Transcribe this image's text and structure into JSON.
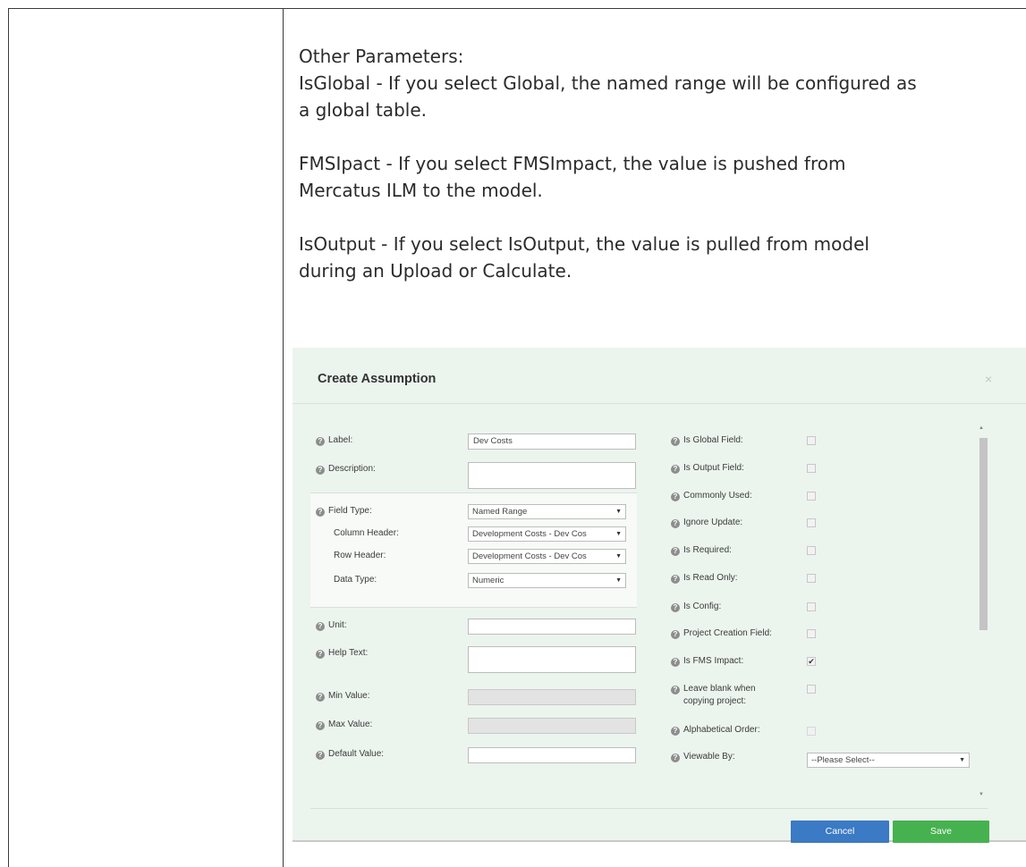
{
  "doc": {
    "lines": [
      "Other Parameters:",
      "IsGlobal - If you select Global, the named range will be configured as",
      "a global table.",
      "FMSIpact - If you select FMSImpact, the value is pushed from",
      "Mercatus ILM to the model.",
      "IsOutput - If you select IsOutput, the value is pulled from model",
      "during an Upload or Calculate."
    ]
  },
  "dialog": {
    "title": "Create Assumption",
    "close_symbol": "×",
    "left_fields": {
      "label": {
        "label": "Label:",
        "value": "Dev Costs"
      },
      "description": {
        "label": "Description:",
        "value": ""
      },
      "field_type": {
        "label": "Field Type:",
        "value": "Named Range"
      },
      "column_header": {
        "label": "Column Header:",
        "value": "Development Costs - Dev Cos"
      },
      "row_header": {
        "label": "Row Header:",
        "value": "Development Costs - Dev Cos"
      },
      "data_type": {
        "label": "Data Type:",
        "value": "Numeric"
      },
      "unit": {
        "label": "Unit:",
        "value": ""
      },
      "help_text": {
        "label": "Help Text:",
        "value": ""
      },
      "min_value": {
        "label": "Min Value:",
        "value": ""
      },
      "max_value": {
        "label": "Max Value:",
        "value": ""
      },
      "default_value": {
        "label": "Default Value:",
        "value": ""
      }
    },
    "right_fields": {
      "is_global": {
        "label": "Is Global Field:",
        "checked": false
      },
      "is_output": {
        "label": "Is Output Field:",
        "checked": false
      },
      "commonly_used": {
        "label": "Commonly Used:",
        "checked": false
      },
      "ignore_update": {
        "label": "Ignore Update:",
        "checked": false
      },
      "is_required": {
        "label": "Is Required:",
        "checked": false
      },
      "is_read_only": {
        "label": "Is Read Only:",
        "checked": false
      },
      "is_config": {
        "label": "Is Config:",
        "checked": false
      },
      "project_creation": {
        "label": "Project Creation Field:",
        "checked": false
      },
      "is_fms_impact": {
        "label": "Is FMS Impact:",
        "checked": true
      },
      "leave_blank": {
        "label1": "Leave blank when",
        "label2": "copying project:",
        "checked": false
      },
      "alphabetical_order": {
        "label": "Alphabetical Order:",
        "checked": false
      },
      "viewable_by": {
        "label": "Viewable By:",
        "value": "--Please Select--"
      }
    },
    "buttons": {
      "cancel": "Cancel",
      "save": "Save"
    },
    "glyphs": {
      "help": "?",
      "check": "✔",
      "arrow": "▼"
    }
  }
}
